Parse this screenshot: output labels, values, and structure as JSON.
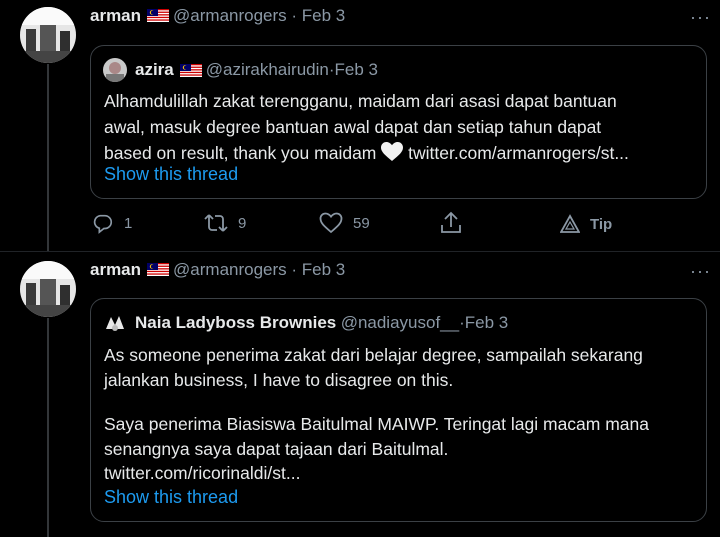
{
  "tweets": [
    {
      "author_name": "arman",
      "handle": "@armanrogers",
      "date": "Feb 3",
      "quoted": {
        "author_name": "azira",
        "handle": "@azirakhairudin",
        "date": "Feb 3",
        "text": "Alhamdulillah zakat terengganu, maidam dari asasi dapat bantuan awal, masuk degree bantuan awal dapat dan setiap tahun dapat based on result, thank you maidam 🤍 twitter.com/armanrogers/st...",
        "text_lines": [
          "Alhamdulillah zakat terengganu, maidam dari asasi dapat bantuan",
          "awal, masuk degree bantuan awal dapat dan setiap tahun dapat",
          "based on result, thank you maidam"
        ],
        "link": "twitter.com/armanrogers/st...",
        "show_thread": "Show this thread"
      },
      "actions": {
        "replies": "1",
        "retweets": "9",
        "likes": "59",
        "tip": "Tip"
      }
    },
    {
      "author_name": "arman",
      "handle": "@armanrogers",
      "date": "Feb 3",
      "quoted": {
        "author_name": "Naia Ladyboss Brownies",
        "handle": "@nadiayusof__",
        "date": "Feb 3",
        "text_lines": [
          "As someone penerima zakat dari belajar degree, sampailah sekarang",
          "jalankan business, I have to disagree on this.",
          "",
          "Saya penerima Biasiswa Baitulmal MAIWP. Teringat lagi macam mana",
          "senangnya saya dapat tajaan dari Baitulmal.",
          "twitter.com/ricorinaldi/st..."
        ],
        "show_thread": "Show this thread"
      }
    }
  ],
  "more_glyph": "···",
  "colors": {
    "accent": "#1d9bf0",
    "muted": "#8b98a5",
    "border": "#3b4045",
    "background": "#000000"
  }
}
